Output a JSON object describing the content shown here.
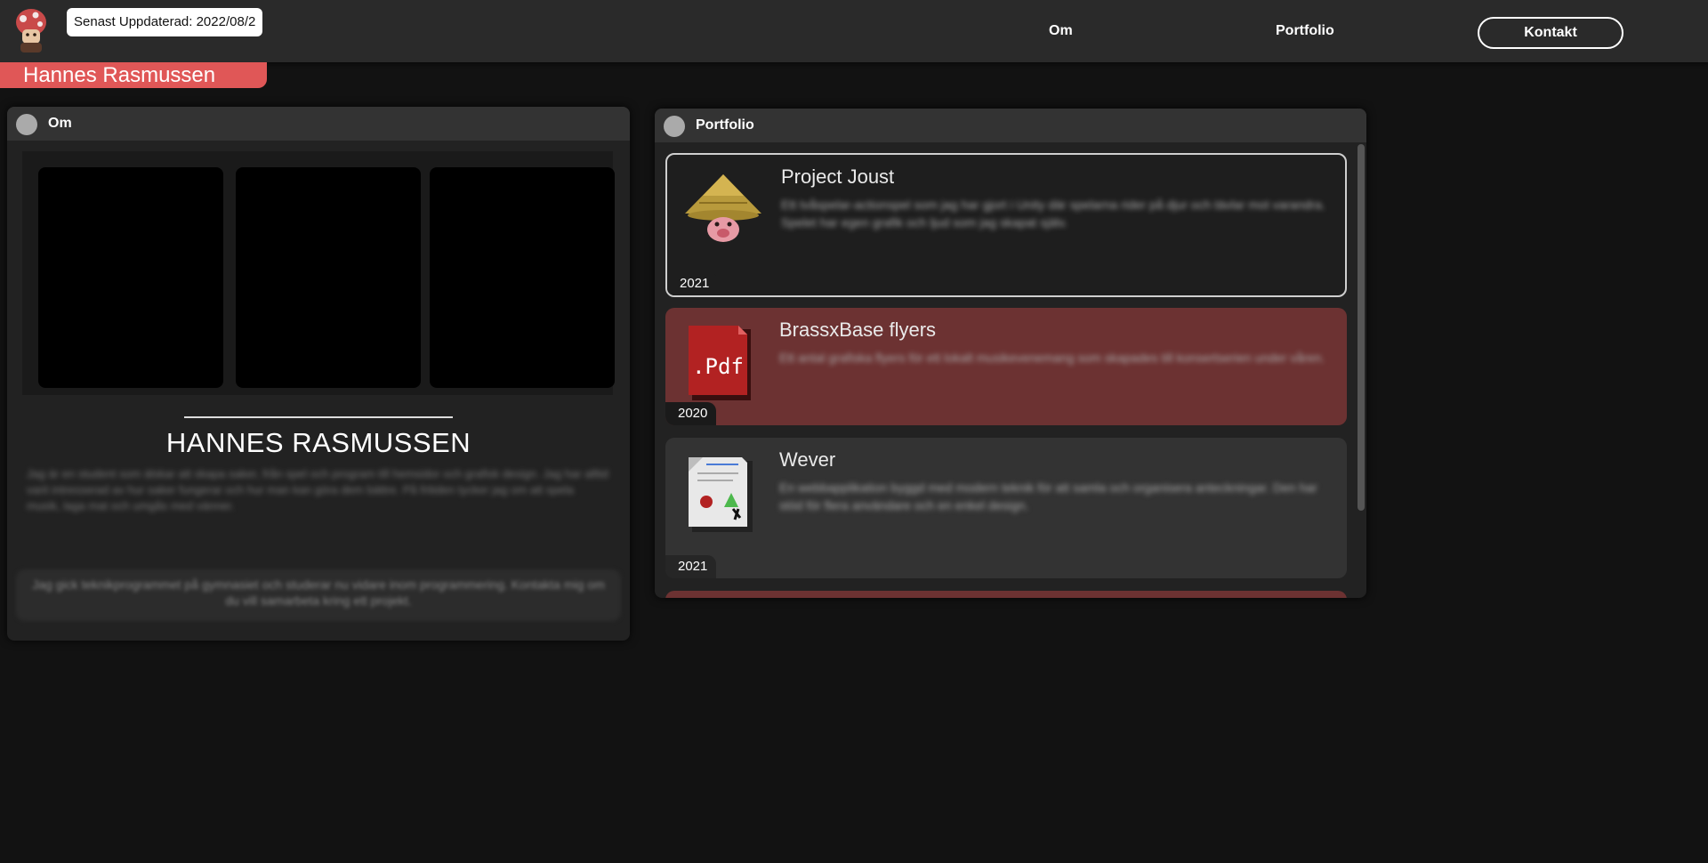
{
  "header": {
    "updated_label": "Senast Uppdaterad: 2022/08/2",
    "nav": {
      "om": "Om",
      "portfolio": "Portfolio",
      "kontakt": "Kontakt"
    },
    "name_tag": "Hannes Rasmussen"
  },
  "om_window": {
    "title": "Om",
    "name": "HANNES RASMUSSEN",
    "bio_text": "Jag är en student som älskar att skapa saker, från spel och program till hemsidor och grafisk design. Jag har alltid varit intresserad av hur saker fungerar och hur man kan göra dem bättre. På fritiden tycker jag om att spela musik, laga mat och umgås med vänner.",
    "footer_text": "Jag gick teknikprogrammet på gymnasiet och studerar nu vidare inom programmering. Kontakta mig om du vill samarbeta kring ett projekt."
  },
  "portfolio_window": {
    "title": "Portfolio",
    "projects": [
      {
        "title": "Project Joust",
        "desc": "Ett tvåspelar-actionspel som jag har gjort i Unity där spelarna rider på djur och tävlar mot varandra. Spelet har egen grafik och ljud som jag skapat själv.",
        "year": "2021",
        "icon": "straw-hat-pig-icon"
      },
      {
        "title": "BrassxBase flyers",
        "desc": "Ett antal grafiska flyers för ett lokalt musikevenemang som skapades till konsertserien under våren.",
        "year": "2020",
        "icon": "pdf-file-icon"
      },
      {
        "title": "Wever",
        "desc": "En webbapplikation byggd med modern teknik för att samla och organisera anteckningar. Den har stöd för flera användare och en enkel design.",
        "year": "2021",
        "icon": "document-file-icon"
      }
    ]
  },
  "colors": {
    "accent_red": "#e05757",
    "card_red": "#6c3232",
    "background": "#121212"
  }
}
